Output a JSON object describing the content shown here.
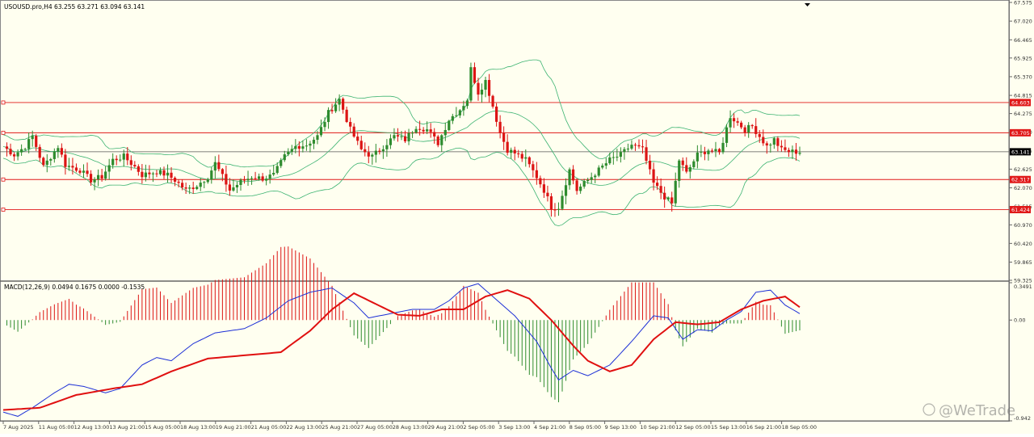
{
  "symbol_header": "USOUSD.pro,H4  63.255 63.271 63.094 63.141",
  "macd_header": "MACD(12,26,9) 0.0494 0.1675 0.0000 -0.1535",
  "watermark": "@WeTrade",
  "colors": {
    "background": "#fffff0",
    "bull_candle": "#2e8b2e",
    "bear_candle": "#dc1414",
    "bands": "#3cb371",
    "level_lines": "#e01818",
    "macd_line": "#1c2fd6",
    "signal_line": "#e01010",
    "hist_up": "#dc1414",
    "hist_down": "#2e8b2e"
  },
  "chart_data": [
    {
      "type": "candlestick",
      "title": "USOUSD.pro, H4",
      "ohlc_header": {
        "open": 63.255,
        "high": 63.271,
        "low": 63.094,
        "close": 63.141
      },
      "price_ticks": [
        67.575,
        67.02,
        66.465,
        65.925,
        65.37,
        64.815,
        64.275,
        63.72,
        63.175,
        62.625,
        62.07,
        61.515,
        60.97,
        60.42,
        59.865,
        59.325
      ],
      "ylim": [
        59.325,
        67.575
      ],
      "horizontal_levels": [
        64.603,
        63.705,
        62.317,
        61.424
      ],
      "current_price_label": 63.141,
      "x_labels": [
        "7 Aug 2025",
        "11 Aug 05:00",
        "12 Aug 13:00",
        "13 Aug 21:00",
        "15 Aug 05:00",
        "18 Aug 13:00",
        "19 Aug 21:00",
        "21 Aug 05:00",
        "22 Aug 13:00",
        "25 Aug 21:00",
        "27 Aug 05:00",
        "28 Aug 13:00",
        "29 Aug 21:00",
        "2 Sep 05:00",
        "3 Sep 13:00",
        "4 Sep 21:00",
        "8 Sep 05:00",
        "9 Sep 13:00",
        "10 Sep 21:00",
        "12 Sep 05:00",
        "15 Sep 13:00",
        "16 Sep 21:00",
        "18 Sep 05:00"
      ],
      "close_path": [
        [
          0,
          63.3
        ],
        [
          3,
          63.05
        ],
        [
          6,
          63.3
        ],
        [
          8,
          63.6
        ],
        [
          11,
          62.7
        ],
        [
          15,
          63.3
        ],
        [
          17,
          62.75
        ],
        [
          21,
          62.6
        ],
        [
          24,
          62.3
        ],
        [
          27,
          62.4
        ],
        [
          30,
          62.9
        ],
        [
          33,
          63.0
        ],
        [
          36,
          62.7
        ],
        [
          38,
          62.45
        ],
        [
          42,
          62.55
        ],
        [
          45,
          62.45
        ],
        [
          47,
          62.3
        ],
        [
          50,
          62.0
        ],
        [
          53,
          62.15
        ],
        [
          56,
          62.4
        ],
        [
          58,
          62.8
        ],
        [
          62,
          62.0
        ],
        [
          65,
          62.25
        ],
        [
          68,
          62.4
        ],
        [
          71,
          62.35
        ],
        [
          74,
          62.45
        ],
        [
          77,
          63.0
        ],
        [
          80,
          63.3
        ],
        [
          83,
          63.35
        ],
        [
          86,
          63.6
        ],
        [
          89,
          64.3
        ],
        [
          92,
          64.7
        ],
        [
          95,
          63.8
        ],
        [
          98,
          63.2
        ],
        [
          101,
          63.0
        ],
        [
          104,
          63.3
        ],
        [
          107,
          63.6
        ],
        [
          110,
          63.5
        ],
        [
          113,
          63.9
        ],
        [
          116,
          63.8
        ],
        [
          119,
          63.4
        ],
        [
          122,
          64.1
        ],
        [
          125,
          64.4
        ],
        [
          127,
          64.7
        ],
        [
          128,
          65.6
        ],
        [
          130,
          64.9
        ],
        [
          132,
          65.25
        ],
        [
          134,
          64.5
        ],
        [
          136,
          63.7
        ],
        [
          138,
          63.2
        ],
        [
          140,
          63.1
        ],
        [
          143,
          62.9
        ],
        [
          146,
          62.4
        ],
        [
          148,
          62.0
        ],
        [
          150,
          61.5
        ],
        [
          152,
          61.5
        ],
        [
          155,
          62.6
        ],
        [
          157,
          62.0
        ],
        [
          160,
          62.3
        ],
        [
          163,
          62.6
        ],
        [
          166,
          62.9
        ],
        [
          169,
          63.05
        ],
        [
          172,
          63.35
        ],
        [
          175,
          63.2
        ],
        [
          178,
          62.2
        ],
        [
          181,
          61.8
        ],
        [
          183,
          61.6
        ],
        [
          185,
          62.9
        ],
        [
          187,
          62.5
        ],
        [
          190,
          63.05
        ],
        [
          193,
          63.2
        ],
        [
          196,
          63.1
        ],
        [
          199,
          64.2
        ],
        [
          201,
          64.0
        ],
        [
          203,
          63.8
        ],
        [
          205,
          63.9
        ],
        [
          207,
          63.6
        ],
        [
          209,
          63.3
        ],
        [
          211,
          63.5
        ],
        [
          213,
          63.2
        ],
        [
          215,
          63.15
        ],
        [
          217,
          63.14
        ]
      ]
    },
    {
      "type": "line+histogram",
      "title": "MACD(12,26,9)",
      "header_values": {
        "main": 0.0494,
        "signal": 0.1675,
        "zero": 0.0,
        "hist": -0.1535
      },
      "y_ticks": [
        0.3491,
        0.0,
        -0.942
      ],
      "ylim": [
        -0.942,
        0.3491
      ],
      "series": [
        {
          "name": "MACD",
          "points": [
            [
              0,
              -0.86
            ],
            [
              4,
              -0.9
            ],
            [
              8,
              -0.82
            ],
            [
              14,
              -0.68
            ],
            [
              18,
              -0.6
            ],
            [
              22,
              -0.62
            ],
            [
              28,
              -0.68
            ],
            [
              32,
              -0.64
            ],
            [
              38,
              -0.42
            ],
            [
              42,
              -0.35
            ],
            [
              46,
              -0.38
            ],
            [
              52,
              -0.22
            ],
            [
              58,
              -0.12
            ],
            [
              66,
              -0.08
            ],
            [
              72,
              0.02
            ],
            [
              78,
              0.18
            ],
            [
              84,
              0.26
            ],
            [
              90,
              0.3
            ],
            [
              96,
              0.16
            ],
            [
              100,
              0.02
            ],
            [
              106,
              0.06
            ],
            [
              112,
              0.1
            ],
            [
              118,
              0.1
            ],
            [
              122,
              0.18
            ],
            [
              126,
              0.3
            ],
            [
              130,
              0.34
            ],
            [
              134,
              0.22
            ],
            [
              140,
              0.04
            ],
            [
              146,
              -0.2
            ],
            [
              150,
              -0.45
            ],
            [
              152,
              -0.56
            ],
            [
              156,
              -0.47
            ],
            [
              160,
              -0.52
            ],
            [
              166,
              -0.42
            ],
            [
              172,
              -0.2
            ],
            [
              178,
              0.04
            ],
            [
              182,
              0.02
            ],
            [
              186,
              -0.18
            ],
            [
              190,
              -0.09
            ],
            [
              194,
              -0.1
            ],
            [
              198,
              0.0
            ],
            [
              202,
              0.08
            ],
            [
              206,
              0.26
            ],
            [
              210,
              0.28
            ],
            [
              214,
              0.14
            ],
            [
              218,
              0.06
            ]
          ]
        },
        {
          "name": "Signal",
          "points": [
            [
              0,
              -0.84
            ],
            [
              10,
              -0.82
            ],
            [
              20,
              -0.7
            ],
            [
              30,
              -0.64
            ],
            [
              38,
              -0.6
            ],
            [
              46,
              -0.48
            ],
            [
              56,
              -0.36
            ],
            [
              66,
              -0.33
            ],
            [
              76,
              -0.3
            ],
            [
              84,
              -0.1
            ],
            [
              90,
              0.1
            ],
            [
              96,
              0.25
            ],
            [
              102,
              0.15
            ],
            [
              108,
              0.05
            ],
            [
              114,
              0.04
            ],
            [
              120,
              0.1
            ],
            [
              126,
              0.1
            ],
            [
              132,
              0.22
            ],
            [
              138,
              0.28
            ],
            [
              144,
              0.2
            ],
            [
              150,
              0.0
            ],
            [
              156,
              -0.24
            ],
            [
              160,
              -0.38
            ],
            [
              166,
              -0.48
            ],
            [
              172,
              -0.42
            ],
            [
              178,
              -0.18
            ],
            [
              184,
              -0.02
            ],
            [
              190,
              -0.04
            ],
            [
              196,
              -0.02
            ],
            [
              202,
              0.1
            ],
            [
              208,
              0.18
            ],
            [
              214,
              0.22
            ],
            [
              218,
              0.12
            ]
          ]
        }
      ]
    }
  ]
}
